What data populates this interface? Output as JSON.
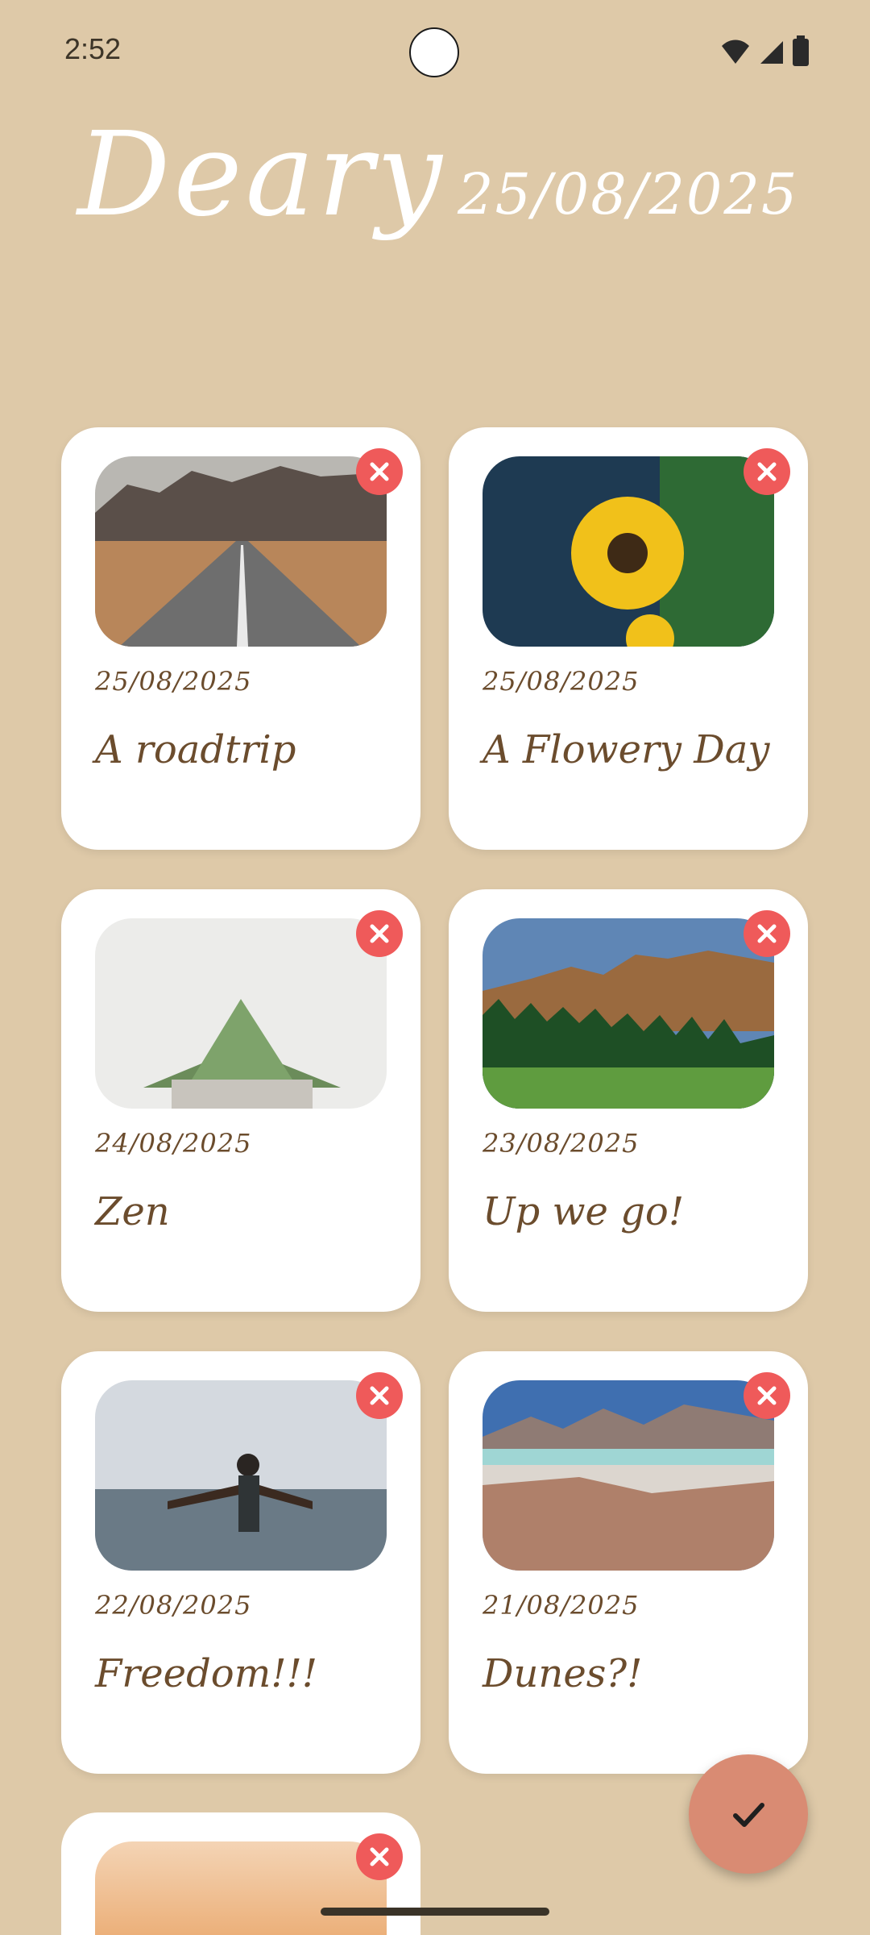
{
  "status_bar": {
    "time": "2:52"
  },
  "header": {
    "app_title": "Deary",
    "date": "25/08/2025"
  },
  "entries": [
    {
      "date": "25/08/2025",
      "title": "A roadtrip",
      "image": "road-mountains"
    },
    {
      "date": "25/08/2025",
      "title": "A Flowery Day",
      "image": "sunflower"
    },
    {
      "date": "24/08/2025",
      "title": "Zen",
      "image": "succulent"
    },
    {
      "date": "23/08/2025",
      "title": "Up we go!",
      "image": "mountain-forest"
    },
    {
      "date": "22/08/2025",
      "title": "Freedom!!!",
      "image": "person-sea"
    },
    {
      "date": "21/08/2025",
      "title": "Dunes?!",
      "image": "desert-lake"
    },
    {
      "date": "",
      "title": "",
      "image": "sunset"
    }
  ],
  "icons": {
    "delete": "close-icon",
    "fab": "check-icon"
  },
  "colors": {
    "background": "#dec9a8",
    "card": "#ffffff",
    "text": "#6b4c2d",
    "delete": "#ef5a5a",
    "fab": "#d98b73"
  }
}
